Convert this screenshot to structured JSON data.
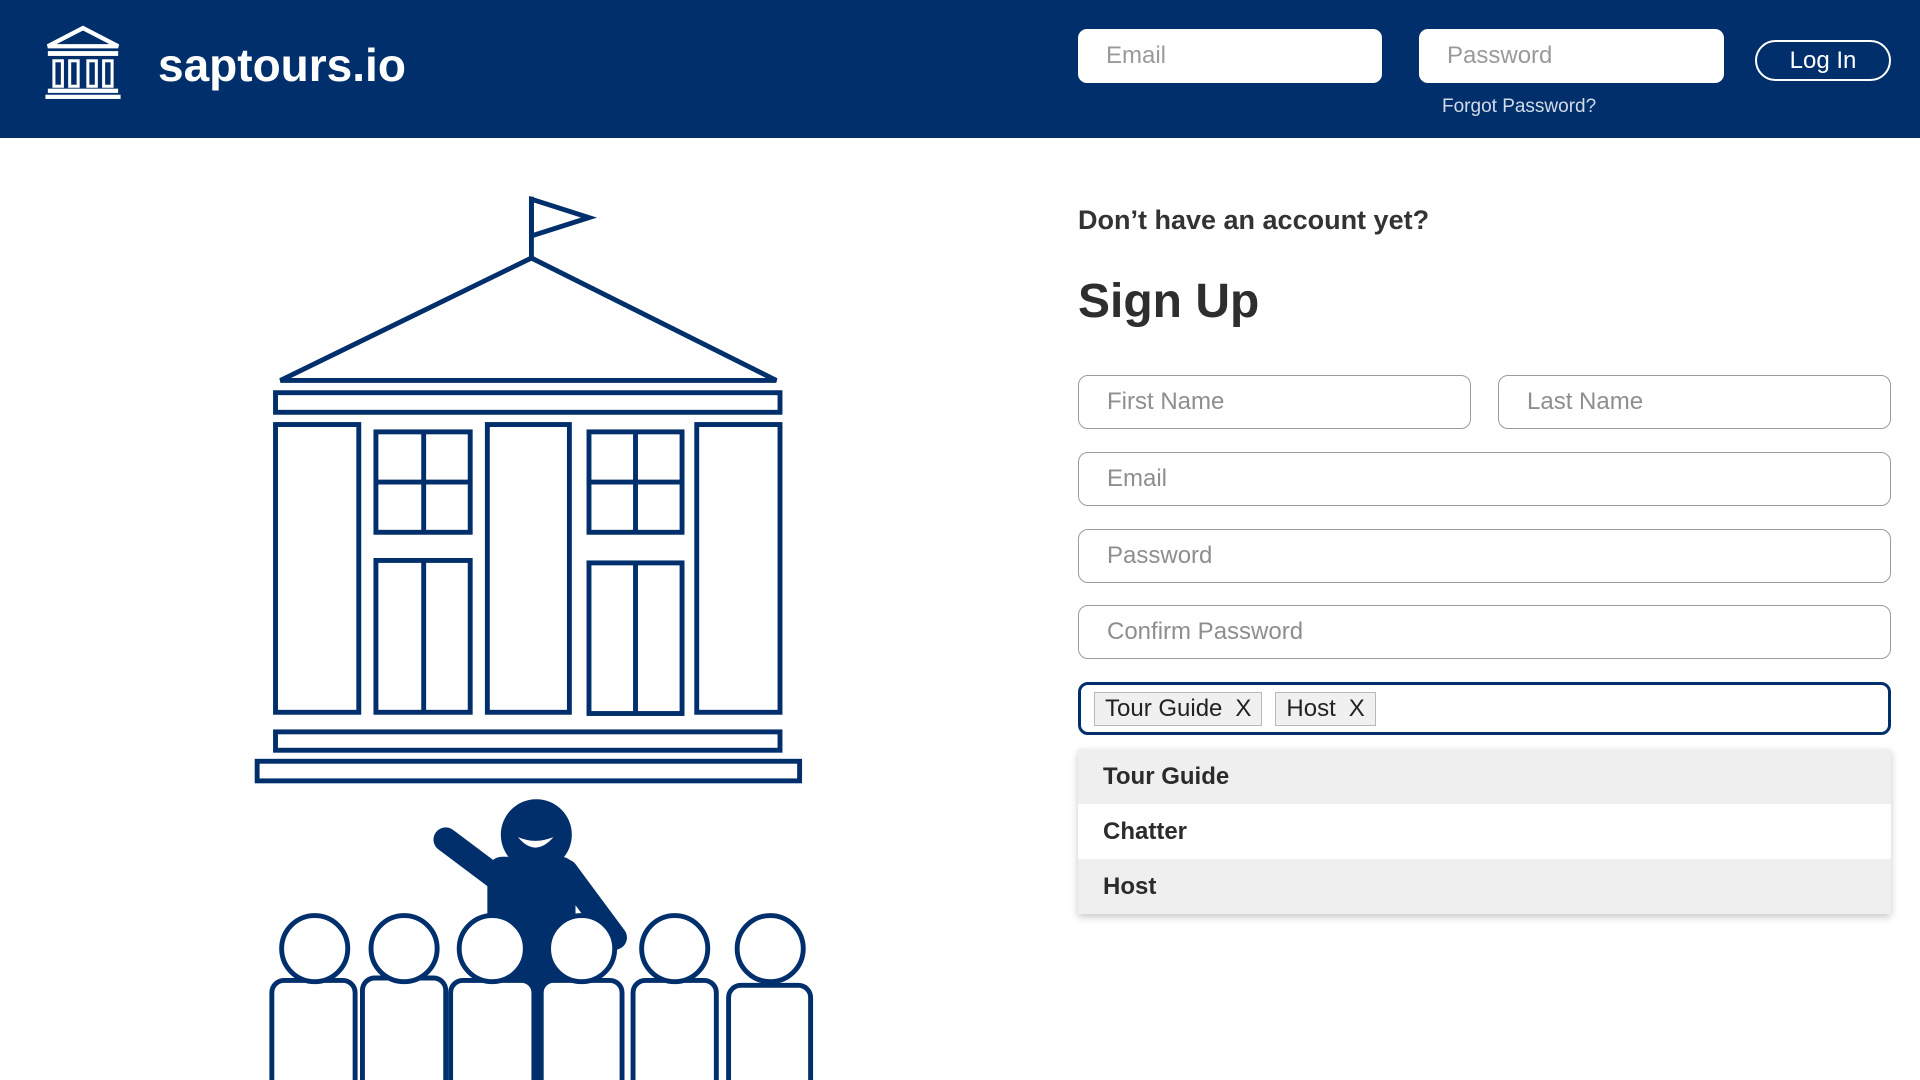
{
  "app": {
    "name": "saptours.io",
    "logo_icon": "museum-icon"
  },
  "colors": {
    "brand": "#012f6b",
    "selected_option_bg": "#efefef",
    "placeholder": "#8e8e8e"
  },
  "header": {
    "email_placeholder": "Email",
    "password_placeholder": "Password",
    "forgot_password": "Forgot Password?",
    "login_label": "Log In"
  },
  "signup": {
    "prompt": "Don’t have an account yet?",
    "title": "Sign Up",
    "fields": {
      "first_name_placeholder": "First Name",
      "last_name_placeholder": "Last Name",
      "email_placeholder": "Email",
      "password_placeholder": "Password",
      "confirm_password_placeholder": "Confirm Password"
    },
    "roles": {
      "selected": [
        {
          "label": "Tour Guide",
          "remove": "X"
        },
        {
          "label": "Host",
          "remove": "X"
        }
      ],
      "options": [
        {
          "label": "Tour Guide",
          "selected": true
        },
        {
          "label": "Chatter",
          "selected": false
        },
        {
          "label": "Host",
          "selected": true
        }
      ]
    }
  },
  "illustration": {
    "icons": [
      "museum-building-icon",
      "flag-icon",
      "tour-guide-icon",
      "tourist-group-icon"
    ]
  }
}
